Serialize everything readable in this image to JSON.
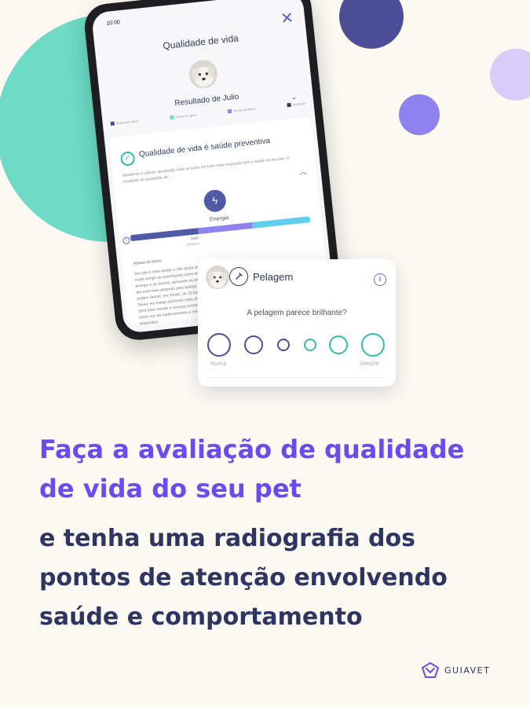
{
  "colors": {
    "background": "#fcf9f3",
    "teal": "#6ddbc5",
    "navy": "#4c4f97",
    "lilac": "#d6cdfb",
    "violet": "#8f82ee",
    "headline_primary": "#6a4bf0",
    "headline_secondary": "#2f3563"
  },
  "tablet": {
    "time": "10:00",
    "title": "Qualidade de vida",
    "result": "Resultado de Julio",
    "legend": [
      "Abaixo do típico",
      "Acima do típico",
      "Dentro do típico",
      "Decifrado"
    ],
    "card_heading": "Qualidade de vida é saúde preventiva",
    "card_desc": "Mantendo o cálculo atualizado você se torna um tutor mais engajado com a saúde do seu pet. O resultado de qualidade de ...",
    "energy_label": "Energia",
    "marker": "Julio",
    "marker_sub": "Ultrasono",
    "subhead": "Abaixo do típico",
    "body": "Seu pet é mais quieto e não gosta de passar muito tempo se exercitando como ele gosta a energia e se divertir, aproveite os momentos que ele está mais disposto para brincar. Gatos podem dormir, em média, de 15 horas por dia. Talvez ele esteja dormindo mais do que gostaria. Será bom manter a energia contínua e detalhes como uso de medicamentos e médico veterinário."
  },
  "question_card": {
    "title": "Pelagem",
    "question": "A pelagem parece brilhante?",
    "options": [
      {
        "name": "option-1",
        "color": "#4c4f97"
      },
      {
        "name": "option-2",
        "color": "#4c4f97"
      },
      {
        "name": "option-3",
        "color": "#4c4f97"
      },
      {
        "name": "option-4",
        "color": "#2fbfa2"
      },
      {
        "name": "option-5",
        "color": "#2fbfa2"
      },
      {
        "name": "option-6",
        "color": "#2fbfa2"
      }
    ],
    "label_left": "Nunca",
    "label_right": "Sempre"
  },
  "headline": {
    "line1": "Faça a avaliação de qualidade",
    "line2": "de vida do seu pet",
    "line3": "e tenha uma radiografia dos",
    "line4": "pontos de atenção envolvendo",
    "line5": "saúde e comportamento"
  },
  "brand": {
    "name": "GUIAVET",
    "icon": "guiavet-logo-icon"
  }
}
